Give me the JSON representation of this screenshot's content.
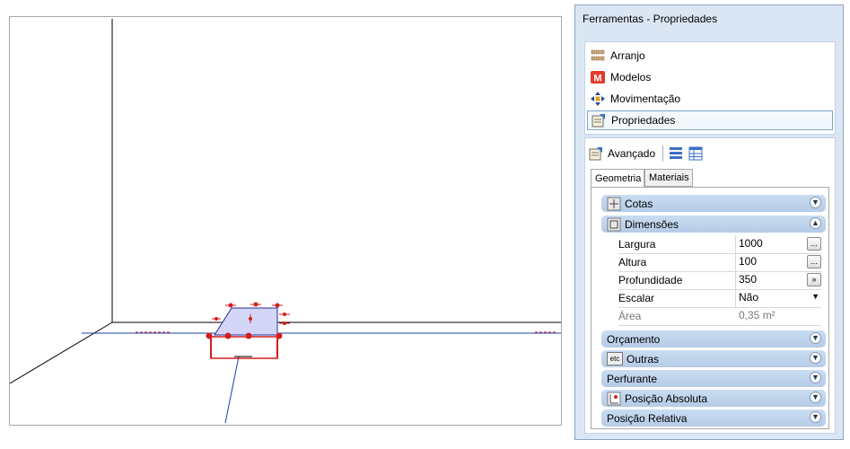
{
  "panel": {
    "title": "Ferramentas - Propriedades",
    "nav": [
      {
        "label": "Arranjo",
        "icon": "arrangement-icon"
      },
      {
        "label": "Modelos",
        "icon": "models-icon"
      },
      {
        "label": "Movimentação",
        "icon": "move-icon"
      },
      {
        "label": "Propriedades",
        "icon": "properties-icon"
      }
    ],
    "advanced": {
      "label": "Avançado"
    },
    "tabs": [
      "Geometria",
      "Materiais"
    ],
    "groups": {
      "cotas": "Cotas",
      "dimensoes": "Dimensões",
      "orcamento": "Orçamento",
      "outras": "Outras",
      "perfurante": "Perfurante",
      "posicao_absoluta": "Posição Absoluta",
      "posicao_relativa": "Posição Relativa"
    },
    "outras_icon_text": "etc",
    "properties": {
      "largura": {
        "label": "Largura",
        "value": "1000",
        "btn": "..."
      },
      "altura": {
        "label": "Altura",
        "value": "100",
        "btn": "..."
      },
      "profundidade": {
        "label": "Profundidade",
        "value": "350",
        "btn": "»"
      },
      "escalar": {
        "label": "Escalar",
        "value": "Não"
      },
      "area": {
        "label": "Área",
        "value": "0,35 m²"
      }
    }
  },
  "colors": {
    "accent": "#7ba3d0",
    "group_bg": "#c9dcf1",
    "model_outline": "#d11f1f",
    "axis": "#1f3fb0"
  }
}
